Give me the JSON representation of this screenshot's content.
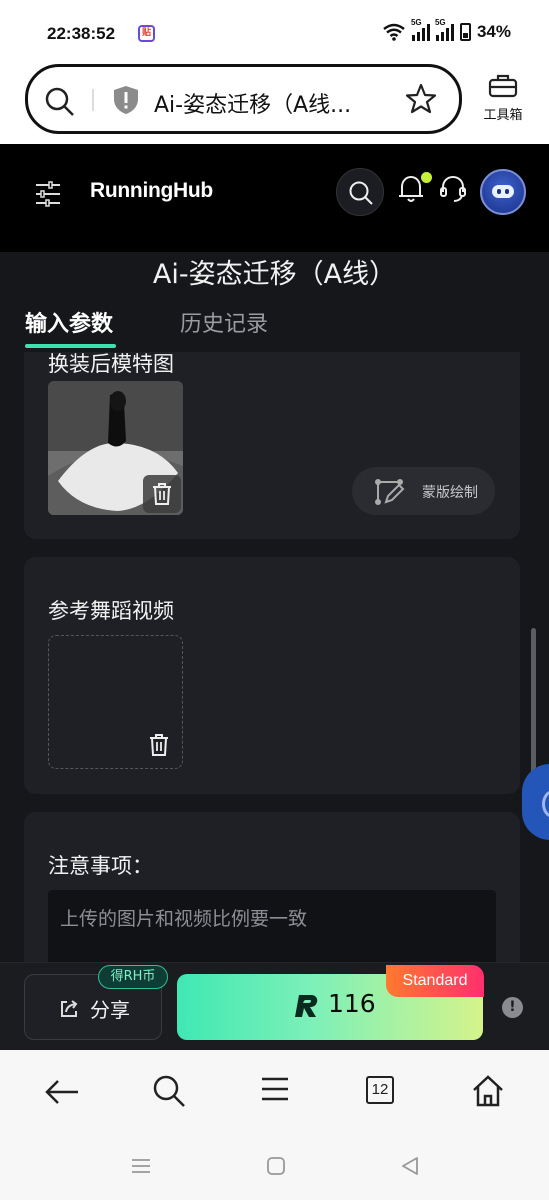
{
  "status": {
    "time": "22:38:52",
    "app_badge": "贴",
    "net1": "5G",
    "net2": "5G",
    "battery": "34%"
  },
  "browser": {
    "url_title": "Ai-姿态迁移（A线...",
    "toolbox_label": "工具箱"
  },
  "app": {
    "logo": "RunningHub"
  },
  "page": {
    "title": "Ai-姿态迁移（A线）",
    "tabs": {
      "input": "输入参数",
      "history": "历史记录"
    }
  },
  "card1": {
    "title": "换装后模特图",
    "mask_button": "蒙版绘制"
  },
  "card2": {
    "title": "参考舞蹈视频"
  },
  "card3": {
    "title": "注意事项：",
    "note": "上传的图片和视频比例要一致"
  },
  "actionbar": {
    "share_label": "分享",
    "earn_badge": "得RH币",
    "run_count": "116",
    "plan_badge": "Standard",
    "info": "!"
  },
  "browser_nav": {
    "tab_count": "12"
  }
}
